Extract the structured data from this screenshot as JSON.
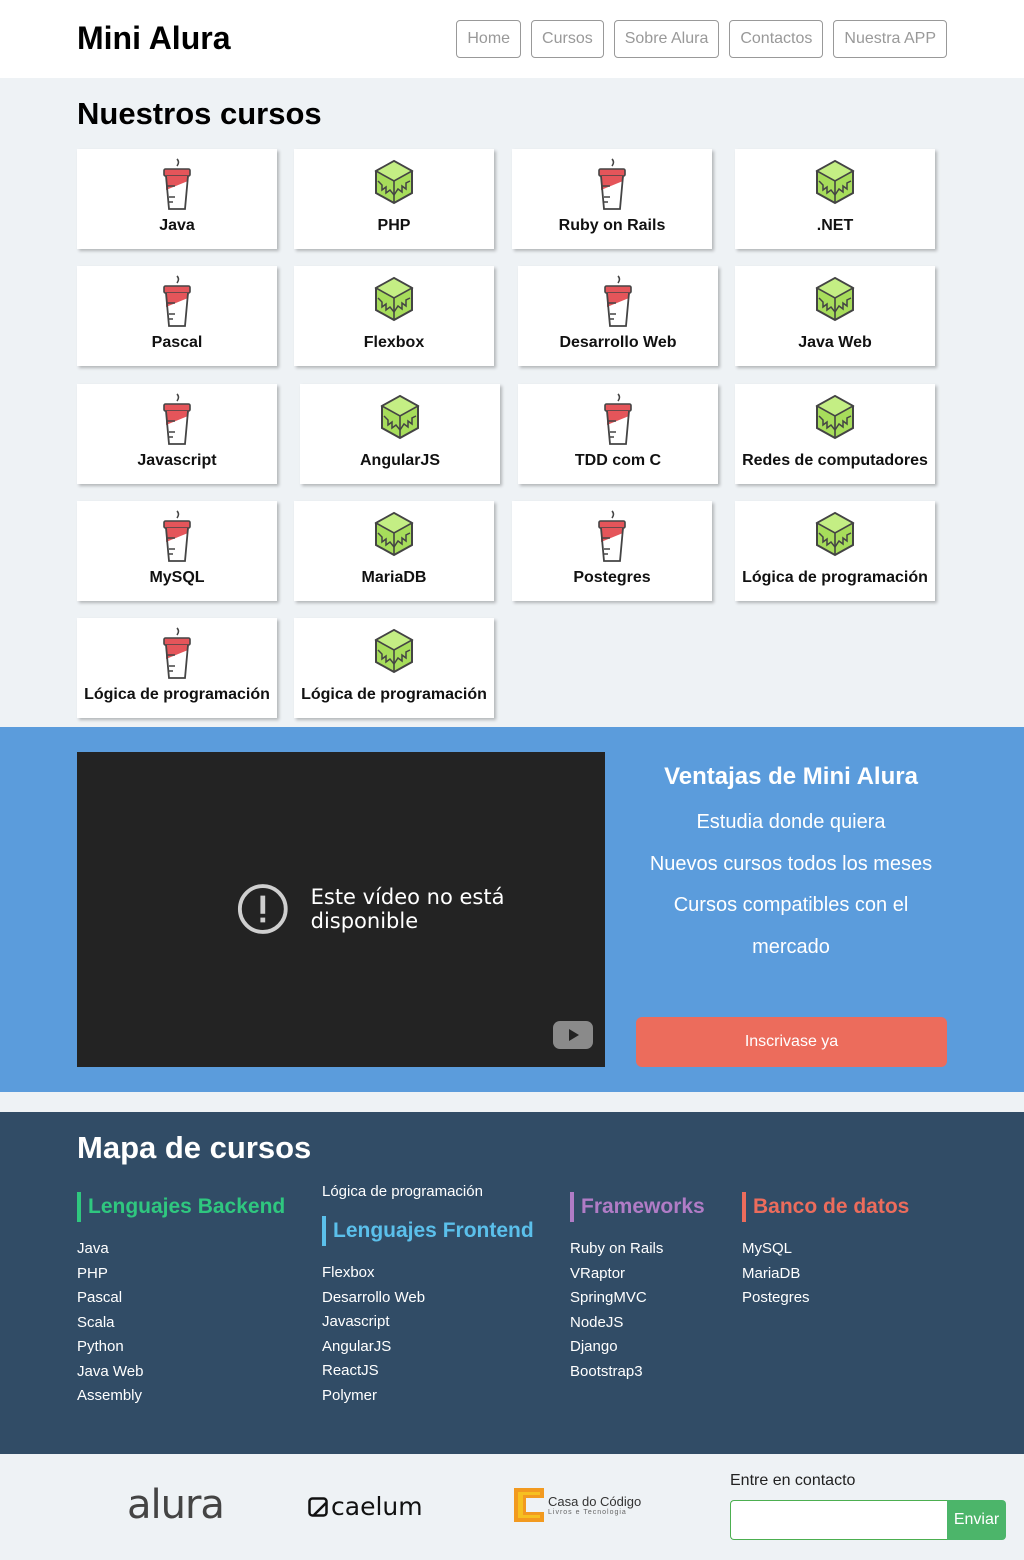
{
  "header": {
    "logo": "Mini Alura",
    "nav": [
      "Home",
      "Cursos",
      "Sobre Alura",
      "Contactos",
      "Nuestra APP"
    ]
  },
  "courses": {
    "title": "Nuestros cursos",
    "items": [
      {
        "label": "Java",
        "icon": "cup-icon"
      },
      {
        "label": "PHP",
        "icon": "cube-icon"
      },
      {
        "label": "Ruby on Rails",
        "icon": "cup-icon"
      },
      {
        "label": ".NET",
        "icon": "cube-icon"
      },
      {
        "label": "Pascal",
        "icon": "cup-icon"
      },
      {
        "label": "Flexbox",
        "icon": "cube-icon"
      },
      {
        "label": "Desarrollo Web",
        "icon": "cup-icon"
      },
      {
        "label": "Java Web",
        "icon": "cube-icon"
      },
      {
        "label": "Javascript",
        "icon": "cup-icon"
      },
      {
        "label": "AngularJS",
        "icon": "cube-icon"
      },
      {
        "label": "TDD com C",
        "icon": "cup-icon"
      },
      {
        "label": "Redes de computadores",
        "icon": "cube-icon"
      },
      {
        "label": "MySQL",
        "icon": "cup-icon"
      },
      {
        "label": "MariaDB",
        "icon": "cube-icon"
      },
      {
        "label": "Postegres",
        "icon": "cup-icon"
      },
      {
        "label": "Lógica de programación",
        "icon": "cube-icon"
      },
      {
        "label": "Lógica de programación",
        "icon": "cup-icon"
      },
      {
        "label": "Lógica de programación",
        "icon": "cube-icon"
      }
    ]
  },
  "advantages": {
    "video_message": "Este vídeo no está disponible",
    "title": "Ventajas de Mini Alura",
    "items": [
      "Estudia donde quiera",
      "Nuevos cursos todos los meses",
      "Cursos compatibles con el mercado"
    ],
    "button": "Inscrivase ya"
  },
  "map": {
    "title": "Mapa de cursos",
    "backend": {
      "title": "Lenguajes Backend",
      "color": "#2fc77f",
      "items": [
        "Java",
        "PHP",
        "Pascal",
        "Scala",
        "Python",
        "Java Web",
        "Assembly"
      ]
    },
    "loose_item": "Lógica de programación",
    "frontend": {
      "title": "Lenguajes Frontend",
      "color": "#5bc0eb",
      "items": [
        "Flexbox",
        "Desarrollo Web",
        "Javascript",
        "AngularJS",
        "ReactJS",
        "Polymer"
      ]
    },
    "frameworks": {
      "title": "Frameworks",
      "color": "#b07cc6",
      "items": [
        "Ruby on Rails",
        "VRaptor",
        "SpringMVC",
        "NodeJS",
        "Django",
        "Bootstrap3"
      ]
    },
    "databases": {
      "title": "Banco de datos",
      "color": "#ec6c5c",
      "items": [
        "MySQL",
        "MariaDB",
        "Postegres"
      ]
    }
  },
  "footer": {
    "brands": {
      "alura": "alura",
      "caelum": "caelum",
      "casa_line1": "Casa do Código",
      "casa_line2": "Livros e Tecnologia"
    },
    "contact_label": "Entre en contacto",
    "contact_value": "",
    "send_button": "Enviar"
  }
}
